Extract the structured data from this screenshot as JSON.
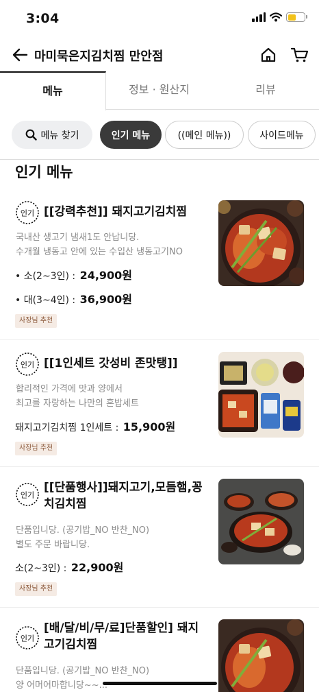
{
  "status": {
    "time": "3:04"
  },
  "header": {
    "store_name": "마미묵은지김치찜 만안점"
  },
  "tabs": [
    {
      "label": "메뉴",
      "active": true
    },
    {
      "label": "정보 · 원산지",
      "active": false
    },
    {
      "label": "리뷰",
      "active": false
    }
  ],
  "chips": {
    "search_label": "메뉴 찾기",
    "items": [
      "인기 메뉴",
      "((메인 메뉴))",
      "사이드메뉴"
    ]
  },
  "section": {
    "title": "인기 메뉴"
  },
  "popular_badge_text": "인기",
  "menu_items": [
    {
      "name": "[[강력추천]] 돼지고기김치찜",
      "description": [
        "국내산 생고기 냄새1도 안납니당.",
        "수개월 냉동고 안에 있는 수입산 냉동고기NO"
      ],
      "prices": [
        {
          "label": "• 소(2~3인) : ",
          "value": "24,900원"
        },
        {
          "label": "• 대(3~4인) : ",
          "value": "36,900원"
        }
      ],
      "badge": "사장님 추천"
    },
    {
      "name": "[[1인세트 갓성비 존맛탱]]",
      "description": [
        "합리적인 가격에 맛과 양에서",
        "최고를 자랑하는 나만의 혼밥세트"
      ],
      "prices": [
        {
          "label": "돼지고기김치찜 1인세트 : ",
          "value": "15,900원"
        }
      ],
      "badge": "사장님 추천"
    },
    {
      "name": "[[단품행사]]돼지고기,모듬햄,꽁치김치찜",
      "description": [
        "단품입니당. (공기밥_NO 반찬_NO)",
        "별도 주문 바랍니당."
      ],
      "prices": [
        {
          "label": "소(2~3인) : ",
          "value": "22,900원"
        }
      ],
      "badge": "사장님 추천"
    },
    {
      "name": "[배/달/비/무/료]단품할인] 돼지고기김치찜",
      "description": [
        "단품입니당. (공기밥_NO 반찬_NO)",
        "양 어머어마합니당~~..."
      ],
      "prices": [],
      "badge": ""
    }
  ],
  "colors": {
    "accent_dark": "#3a3a3a",
    "badge_bg": "#f5ebe4",
    "badge_text": "#8c5a3c",
    "battery": "#f2c21b"
  }
}
